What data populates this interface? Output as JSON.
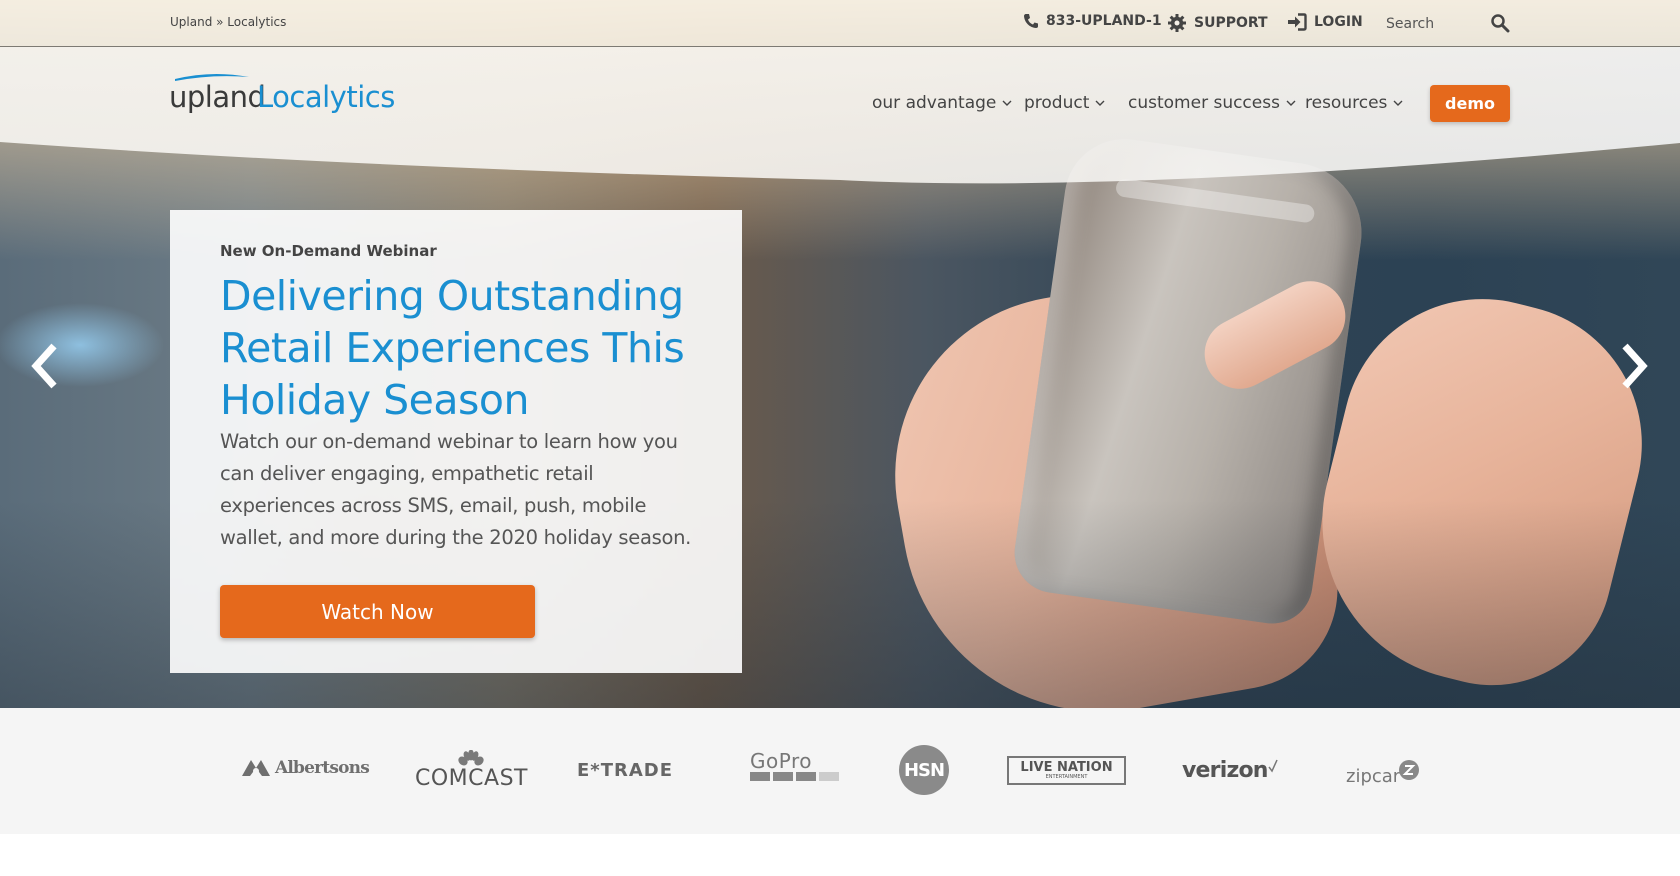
{
  "topbar": {
    "breadcrumb": "Upland » Localytics",
    "phone_label": "833-UPLAND-1",
    "support_label": "SUPPORT",
    "login_label": "LOGIN",
    "search_placeholder": "Search"
  },
  "logo": {
    "part1": "upland",
    "part2": "Localytics"
  },
  "mainnav": {
    "items": [
      {
        "label": "our advantage"
      },
      {
        "label": "product"
      },
      {
        "label": "customer success"
      },
      {
        "label": "resources"
      }
    ],
    "demo_label": "demo"
  },
  "hero": {
    "eyebrow": "New On-Demand Webinar",
    "headline": "Delivering Outstanding Retail Experiences This Holiday Season",
    "body": "Watch our on-demand webinar to learn how you can deliver engaging, empathetic retail experiences across SMS, email, push, mobile wallet, and more during the 2020 holiday season.",
    "cta_label": "Watch Now"
  },
  "customers": {
    "albertsons": "Albertsons",
    "comcast": "COMCAST",
    "etrade": "E*TRADE",
    "gopro": "GoPro",
    "hsn": "HSN",
    "livenation": "LIVE NATION",
    "livenation_sub": "ENTERTAINMENT",
    "verizon": "verizon",
    "zipcar": "zipcar"
  },
  "colors": {
    "accent_orange": "#e5691c",
    "brand_blue": "#1a8fd1",
    "text_dark": "#444444"
  }
}
